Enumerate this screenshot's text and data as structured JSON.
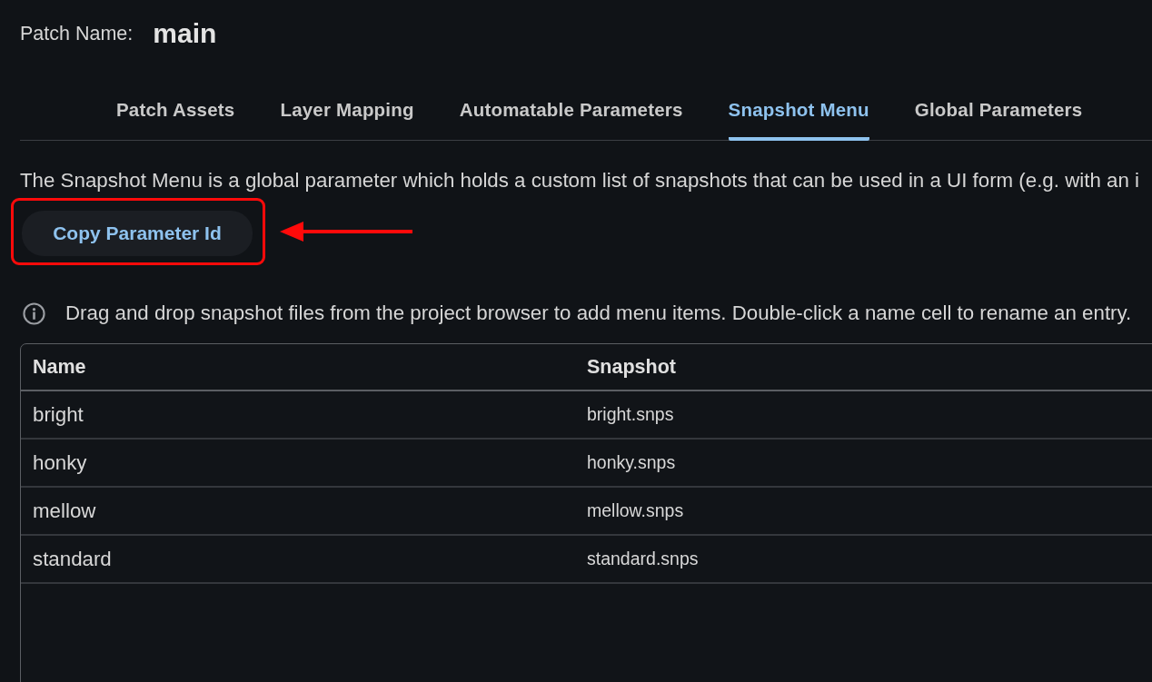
{
  "patch": {
    "label": "Patch Name:",
    "value": "main"
  },
  "tabs": [
    {
      "label": "Patch Assets",
      "selected": false
    },
    {
      "label": "Layer Mapping",
      "selected": false
    },
    {
      "label": "Automatable Parameters",
      "selected": false
    },
    {
      "label": "Snapshot Menu",
      "selected": true
    },
    {
      "label": "Global Parameters",
      "selected": false
    }
  ],
  "description": "The Snapshot Menu is a global parameter which holds a custom list of snapshots that can be used in a UI form (e.g. with an i",
  "copy_button": {
    "label": "Copy Parameter Id"
  },
  "annotation": {
    "frame": true,
    "arrow": true
  },
  "info": {
    "text": "Drag and drop snapshot files from the project browser to add menu items. Double-click a name cell to rename an entry."
  },
  "table": {
    "columns": [
      "Name",
      "Snapshot"
    ],
    "rows": [
      [
        "bright",
        "bright.snps"
      ],
      [
        "honky",
        "honky.snps"
      ],
      [
        "mellow",
        "mellow.snps"
      ],
      [
        "standard",
        "standard.snps"
      ]
    ]
  }
}
